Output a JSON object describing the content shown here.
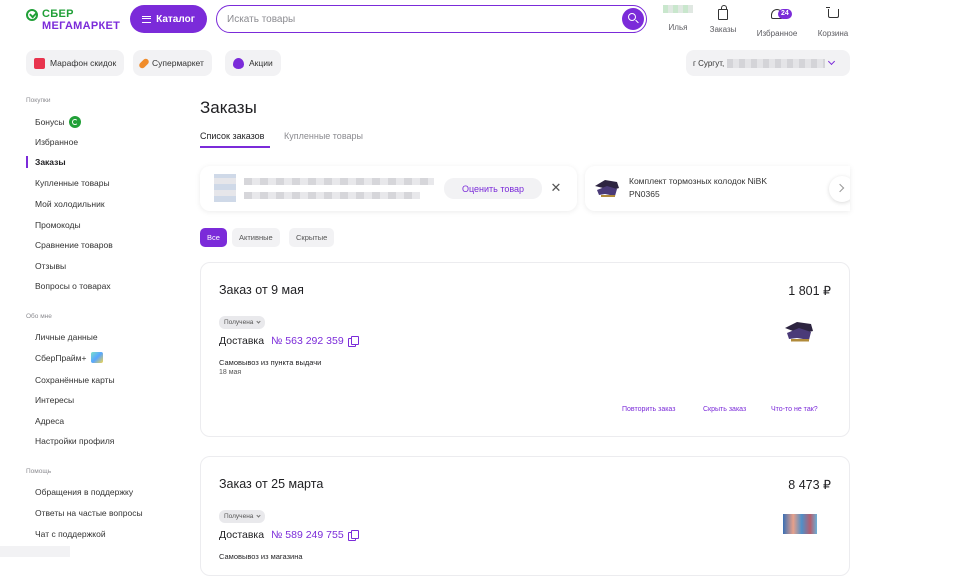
{
  "header": {
    "logo_line1": "СБЕР",
    "logo_line2": "МЕГАМАРКЕТ",
    "catalog_label": "Каталог",
    "search_placeholder": "Искать товары",
    "user_label": "Илья",
    "orders_label": "Заказы",
    "favorites_label": "Избранное",
    "favorites_count": "24",
    "cart_label": "Корзина"
  },
  "quick_links": [
    {
      "label": "Марафон скидок",
      "icon": "discount-icon",
      "color": "#e8344e"
    },
    {
      "label": "Супермаркет",
      "icon": "carrot-icon",
      "color": "#f08c2a"
    },
    {
      "label": "Акции",
      "icon": "fire-icon",
      "color": "#7b2bd9"
    }
  ],
  "city": {
    "label": "г Сургут,"
  },
  "sidebar": {
    "group_purchases": "Покупки",
    "purchases": [
      "Бонусы",
      "Избранное",
      "Заказы",
      "Купленные товары",
      "Мой холодильник",
      "Промокоды",
      "Сравнение товаров",
      "Отзывы",
      "Вопросы о товарах"
    ],
    "group_about": "Обо мне",
    "about": [
      "Личные данные",
      "СберПрайм+",
      "Сохранённые карты",
      "Интересы",
      "Адреса",
      "Настройки профиля"
    ],
    "group_help": "Помощь",
    "help": [
      "Обращения в поддержку",
      "Ответы на частые вопросы",
      "Чат с поддержкой"
    ]
  },
  "main": {
    "title": "Заказы",
    "tabs": [
      "Список заказов",
      "Купленные товары"
    ],
    "rate_button": "Оценить товар",
    "product_name": "Комплект тормозных колодок NiBK PN0365",
    "filters": [
      "Все",
      "Активные",
      "Скрытые"
    ]
  },
  "orders": [
    {
      "title": "Заказ от 9 мая",
      "price": "1 801 ₽",
      "status": "Получена",
      "delivery": "Доставка",
      "number": "№ 563 292 359",
      "pickup": "Самовывоз из пункта выдачи",
      "date": "18 мая",
      "actions": [
        "Повторить заказ",
        "Скрыть заказ",
        "Что-то не так?"
      ]
    },
    {
      "title": "Заказ от 25 марта",
      "price": "8 473 ₽",
      "status": "Получена",
      "delivery": "Доставка",
      "number": "№ 589 249 755",
      "pickup": "Самовывоз из магазина"
    }
  ],
  "colors": {
    "accent": "#7b2bd9",
    "brand_green": "#21a038"
  }
}
